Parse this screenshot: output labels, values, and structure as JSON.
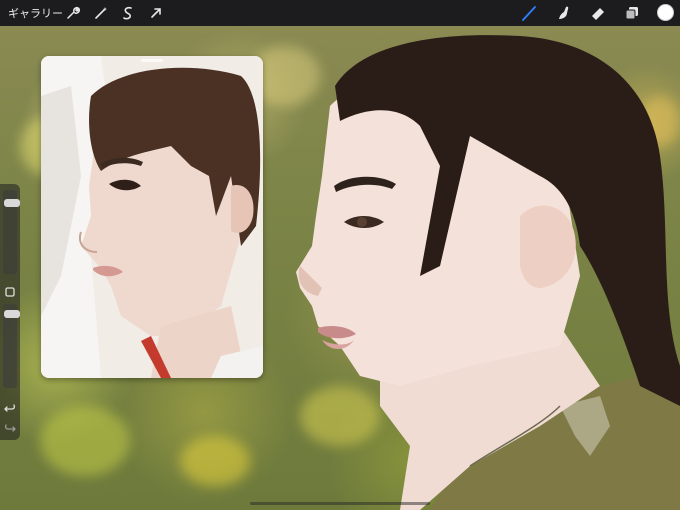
{
  "topbar": {
    "gallery_label": "ギャラリー",
    "left_tools": [
      "wrench-icon",
      "magic-wand-icon",
      "selection-icon",
      "transform-arrow-icon"
    ],
    "right_tools": [
      "brush-icon",
      "smudge-icon",
      "eraser-icon",
      "layers-icon"
    ],
    "active_tool": "brush-icon",
    "accent_color": "#2f7bf6",
    "current_color": "#ffffff"
  },
  "sidebar": {
    "brush_size_level": 0.12,
    "opacity_level": 0.08,
    "buttons": [
      "modify-square-icon",
      "undo-icon",
      "redo-icon"
    ]
  },
  "reference": {
    "title_handle": "reference-window"
  }
}
